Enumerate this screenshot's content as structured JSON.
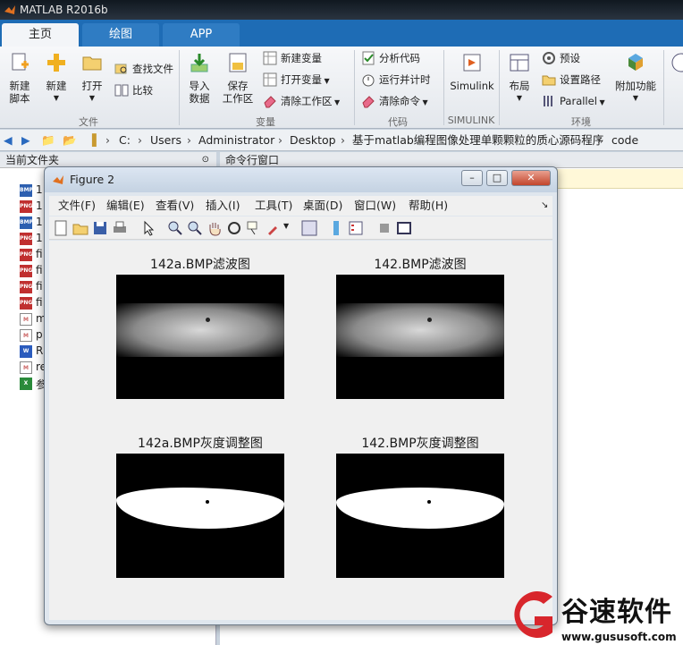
{
  "app": {
    "title": "MATLAB R2016b"
  },
  "tabs": [
    {
      "label": "主页"
    },
    {
      "label": "绘图"
    },
    {
      "label": "APP"
    }
  ],
  "ribbon": {
    "file": {
      "new_script": "新建\n脚本",
      "new": "新建",
      "open": "打开",
      "find_files": "查找文件",
      "compare": "比较",
      "group": "文件"
    },
    "variable": {
      "import": "导入\n数据",
      "save_ws": "保存\n工作区",
      "new_var": "新建变量",
      "open_var": "打开变量",
      "clear_ws": "清除工作区",
      "group": "变量"
    },
    "code": {
      "analyze": "分析代码",
      "run_time": "运行并计时",
      "clear_cmd": "清除命令",
      "group": "代码"
    },
    "simulink": {
      "simulink": "Simulink",
      "group": "SIMULINK"
    },
    "env": {
      "layout": "布局",
      "prefs": "预设",
      "set_path": "设置路径",
      "parallel": "Parallel",
      "addons": "附加功能",
      "group": "环境"
    }
  },
  "address": {
    "crumbs": [
      "C:",
      "Users",
      "Administrator",
      "Desktop",
      "基于matlab编程图像处理单颗颗粒的质心源码程序",
      "code"
    ]
  },
  "left_panel": {
    "title": "当前文件夹",
    "files": [
      {
        "type": "BMP",
        "name": "1"
      },
      {
        "type": "PNG",
        "name": "1"
      },
      {
        "type": "BMP",
        "name": "1"
      },
      {
        "type": "PNG",
        "name": "1"
      },
      {
        "type": "PNG",
        "name": "fi"
      },
      {
        "type": "PNG",
        "name": "fi"
      },
      {
        "type": "PNG",
        "name": "fi"
      },
      {
        "type": "PNG",
        "name": "fi"
      },
      {
        "type": "M",
        "name": "m"
      },
      {
        "type": "M",
        "name": "p"
      },
      {
        "type": "W",
        "name": "R"
      },
      {
        "type": "M",
        "name": "re"
      },
      {
        "type": "X",
        "name": "参"
      }
    ]
  },
  "right_panel": {
    "title": "命令行窗口"
  },
  "figure": {
    "title": "Figure 2",
    "menu": [
      "文件(F)",
      "编辑(E)",
      "查看(V)",
      "插入(I)",
      "工具(T)",
      "桌面(D)",
      "窗口(W)",
      "帮助(H)"
    ],
    "plots": [
      {
        "title": "142a.BMP滤波图"
      },
      {
        "title": "142.BMP滤波图"
      },
      {
        "title": "142a.BMP灰度调整图"
      },
      {
        "title": "142.BMP灰度调整图"
      }
    ]
  },
  "watermark": {
    "brand": "谷速软件",
    "url": "www.gususoft.com"
  },
  "colors": {
    "matlab_blue": "#1e6cb5",
    "ribbon_bg": "#eef1f4",
    "figure_bg": "#f0f0f0"
  }
}
